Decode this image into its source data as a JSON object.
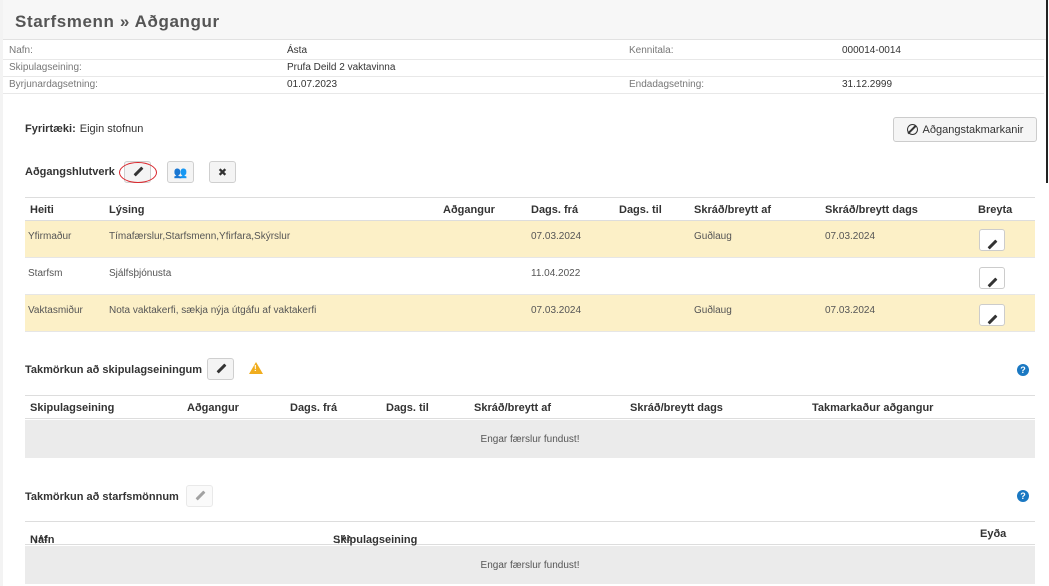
{
  "page": {
    "title": "Starfsmenn » Aðgangur"
  },
  "employee": {
    "name_label": "Nafn:",
    "name": "Ásta",
    "kennitala_label": "Kennitala:",
    "kennitala": "000014-0014",
    "unit_label": "Skipulagseining:",
    "unit": "Prufa Deild 2 vaktavinna",
    "start_label": "Byrjunardagsetning:",
    "start": "01.07.2023",
    "end_label": "Endadagsetning:",
    "end": "31.12.2999"
  },
  "company": {
    "label": "Fyrirtæki:",
    "value": "Eigin stofnun"
  },
  "restrict_button": "Aðgangstakmarkanir",
  "roles": {
    "title": "Aðgangshlutverk",
    "columns": [
      "Heiti",
      "Lýsing",
      "Aðgangur",
      "Dags. frá",
      "Dags. til",
      "Skráð/breytt af",
      "Skráð/breytt dags",
      "Breyta"
    ],
    "rows": [
      {
        "name": "Yfirmaður",
        "desc": "Tímafærslur,Starfsmenn,Yfirfara,Skýrslur",
        "access": "",
        "from": "07.03.2024",
        "to": "",
        "by": "Guðlaug",
        "date": "07.03.2024",
        "highlight": true
      },
      {
        "name": "Starfsm",
        "desc": "Sjálfsþjónusta",
        "access": "",
        "from": "11.04.2022",
        "to": "",
        "by": "",
        "date": "",
        "highlight": false
      },
      {
        "name": "Vaktasmiður",
        "desc": "Nota vaktakerfi, sækja nýja útgáfu af vaktakerfi",
        "access": "",
        "from": "07.03.2024",
        "to": "",
        "by": "Guðlaug",
        "date": "07.03.2024",
        "highlight": true
      }
    ]
  },
  "unit_restrictions": {
    "title": "Takmörkun að skipulagseiningum",
    "columns": [
      "Skipulagseining",
      "Aðgangur",
      "Dags. frá",
      "Dags. til",
      "Skráð/breytt af",
      "Skráð/breytt dags",
      "Takmarkaður aðgangur"
    ],
    "empty": "Engar færslur fundust!"
  },
  "staff_restrictions": {
    "title": "Takmörkun að starfsmönnum",
    "columns": [
      "Nafn",
      "Skipulagseining",
      "Eyða"
    ],
    "empty": "Engar færslur fundust!"
  },
  "icons": {
    "edit": "pencil-icon",
    "group": "users-icon",
    "remove": "times-icon",
    "ban": "ban-icon",
    "warning": "warning-icon",
    "help": "question-circle-icon",
    "sort": "sort-alpha-icon"
  },
  "colors": {
    "highlight_row": "#fcf0c7",
    "accent": "#1a78c2",
    "warning": "#f0ad1e",
    "annotation": "#d9262c"
  }
}
